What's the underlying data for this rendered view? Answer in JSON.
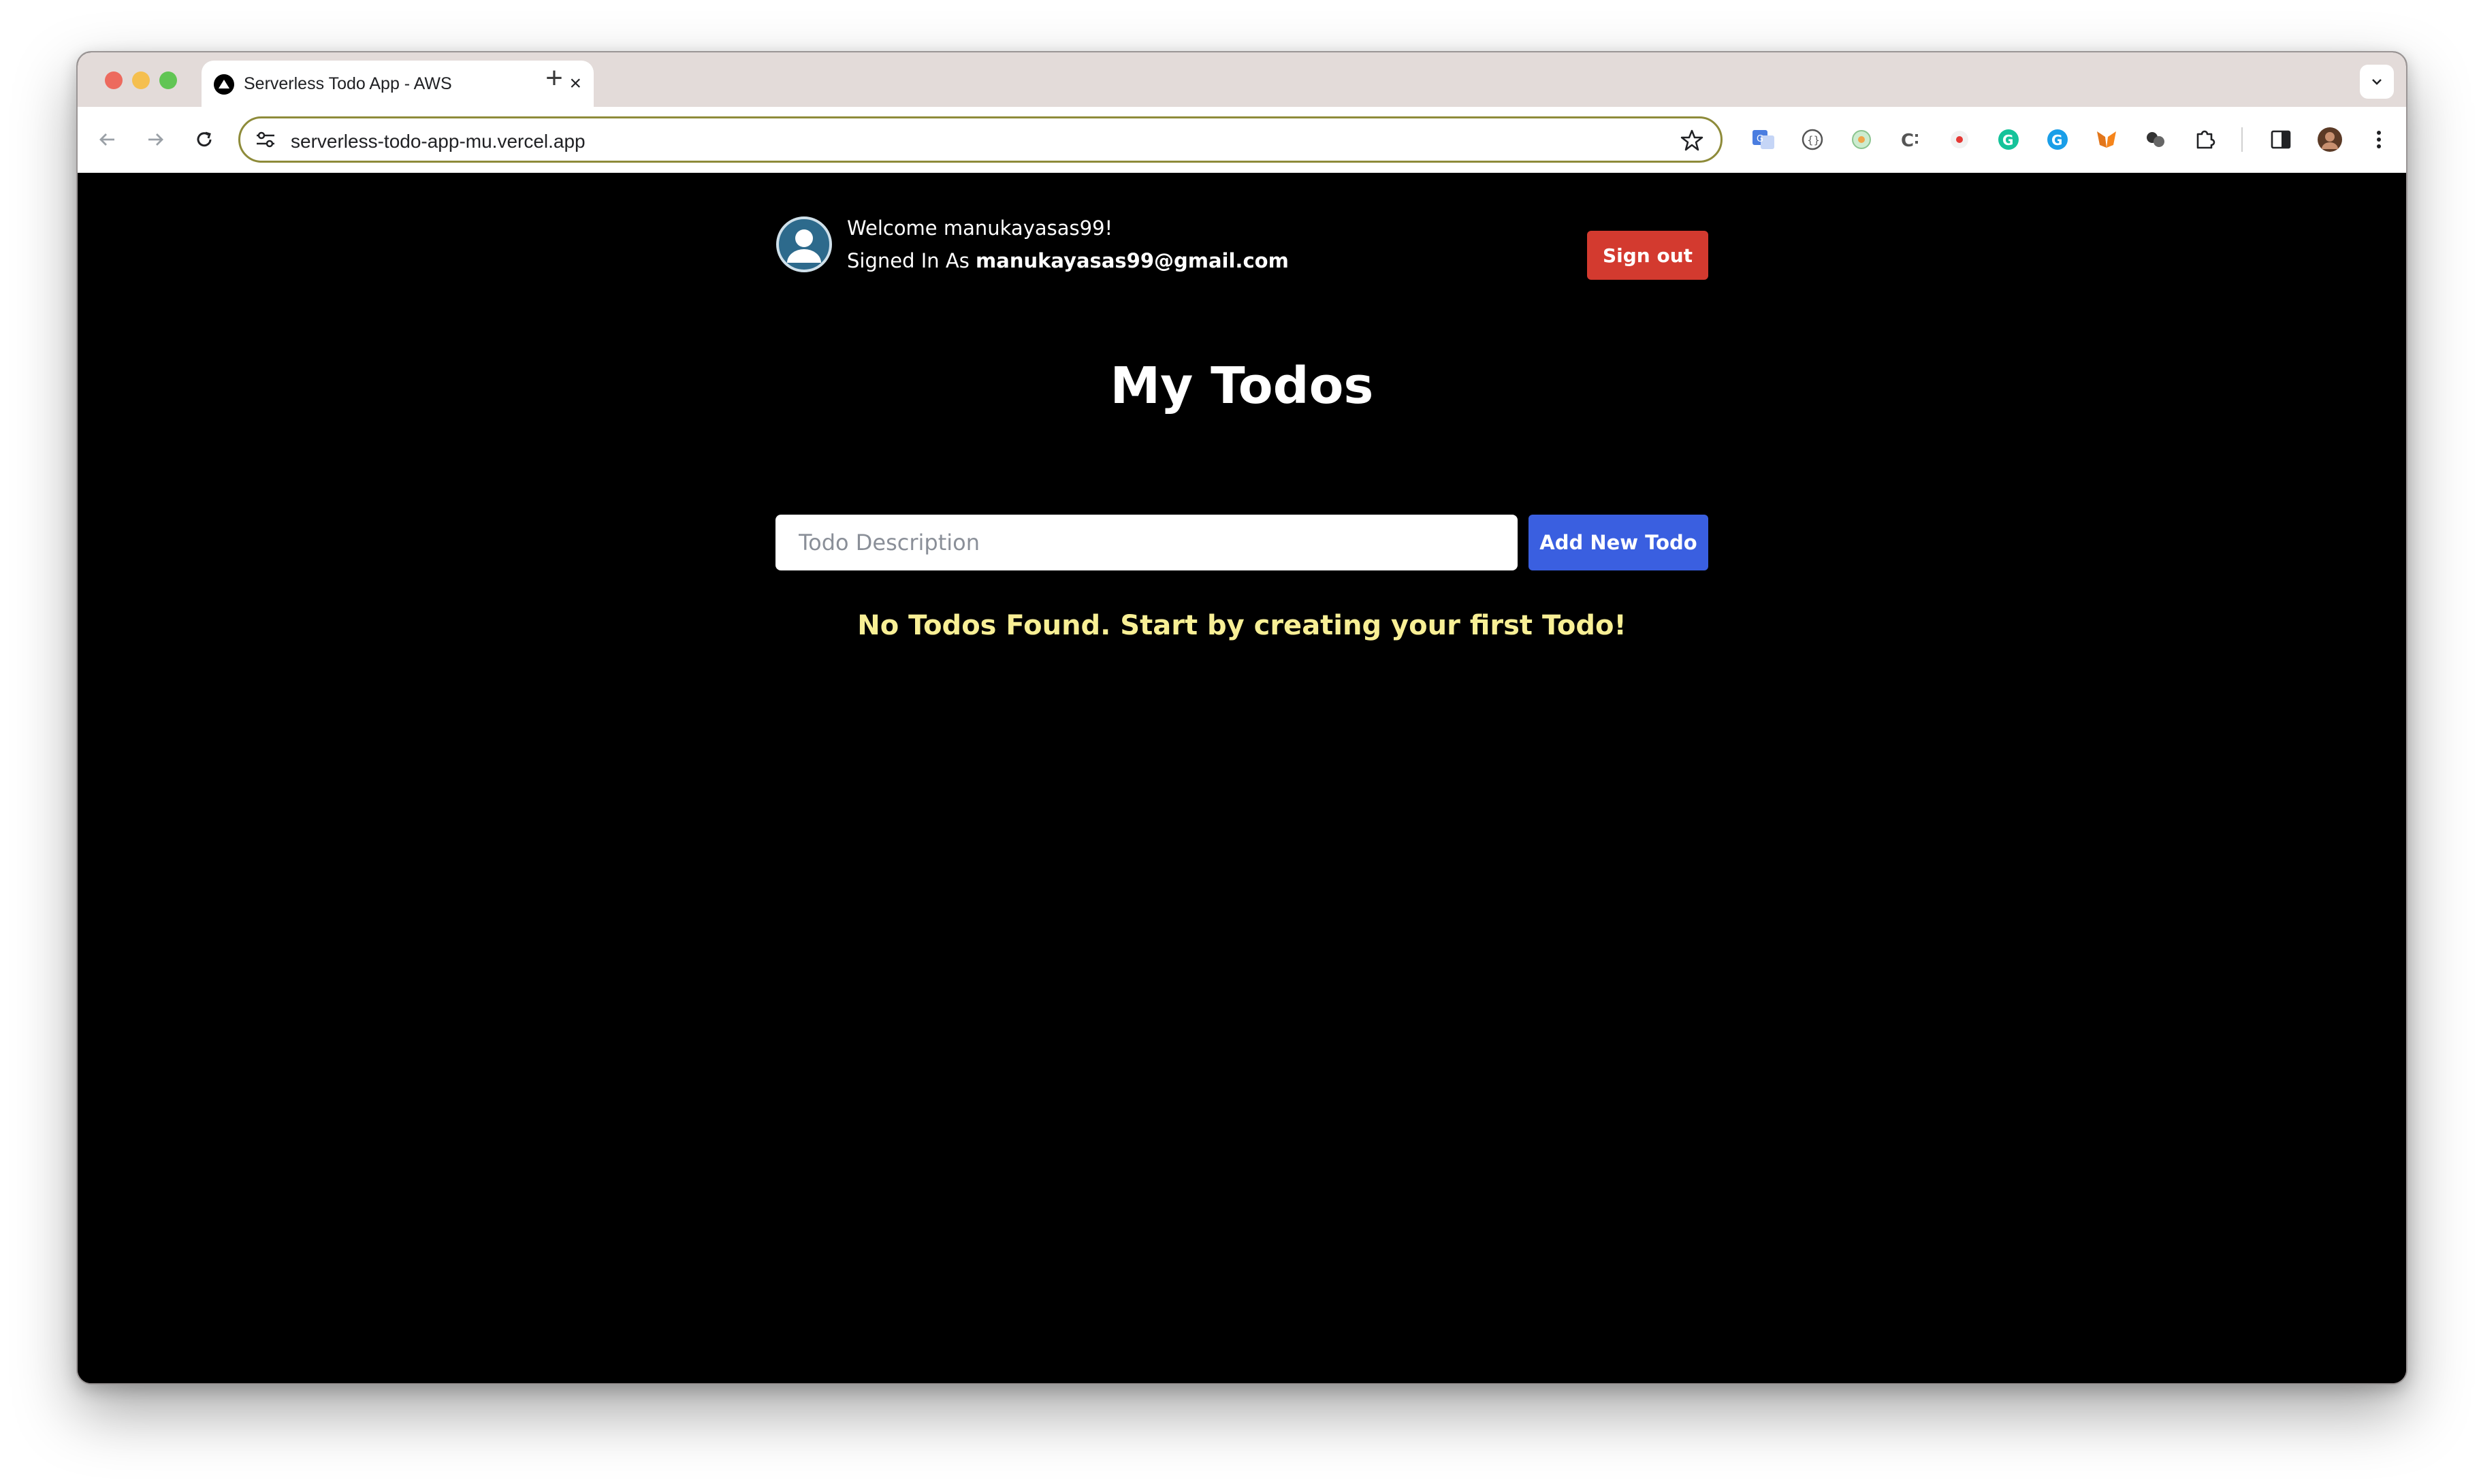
{
  "browser": {
    "tab_title": "Serverless Todo App - AWS",
    "url": "serverless-todo-app-mu.vercel.app"
  },
  "header": {
    "welcome": "Welcome manukayasas99!",
    "signed_in_prefix": "Signed In As ",
    "email": "manukayasas99@gmail.com",
    "sign_out_label": "Sign out"
  },
  "main": {
    "title": "My Todos",
    "input_placeholder": "Todo Description",
    "add_label": "Add New Todo",
    "empty_message": "No Todos Found. Start by creating your first Todo!"
  },
  "colors": {
    "sign_out": "#d33a2f",
    "add_button": "#3a5fe0",
    "empty_message": "#f8ef95",
    "page_bg": "#000000"
  }
}
